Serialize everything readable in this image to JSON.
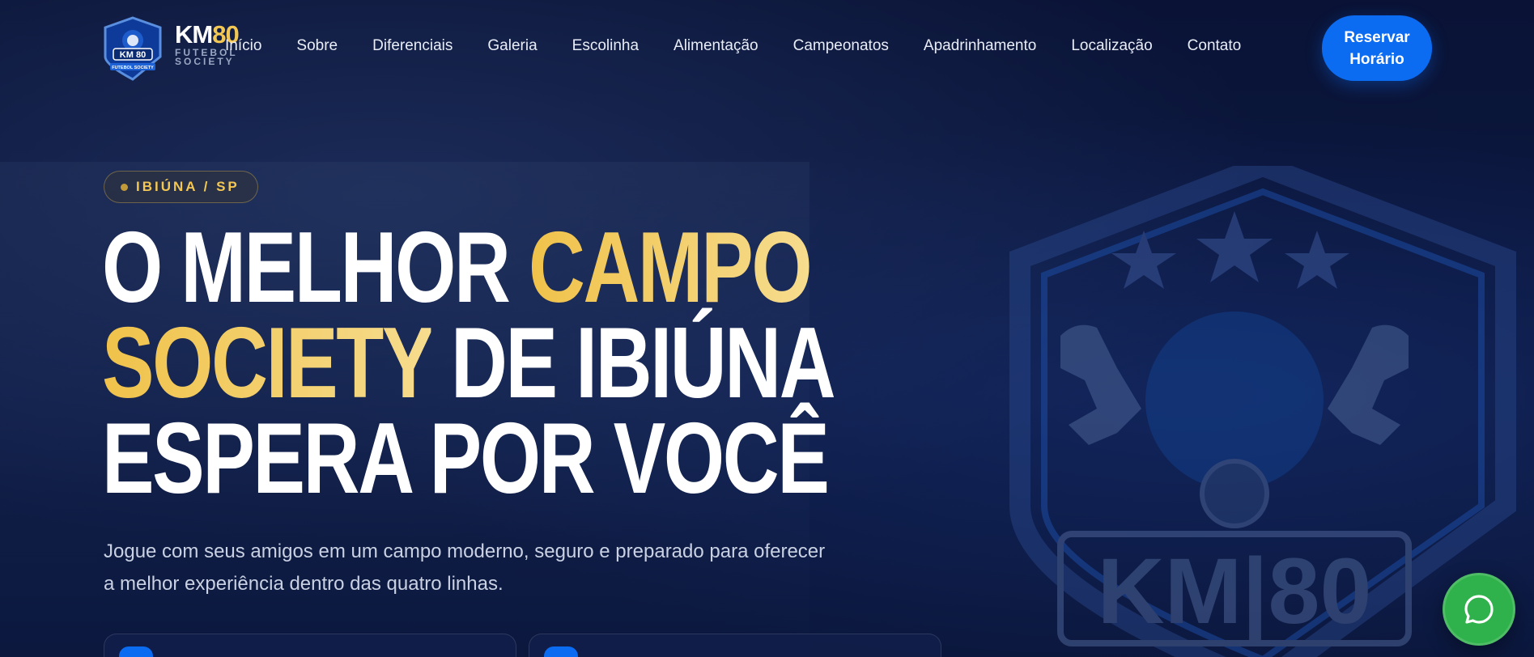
{
  "header": {
    "logo": {
      "brand_main": "KM",
      "brand_accent": "80",
      "brand_sub_1": "FUTEBOL",
      "brand_sub_2": "SOCIETY",
      "badge_text": "KM 80",
      "badge_ribbon": "FUTEBOL SOCIETY"
    },
    "nav": [
      "Início",
      "Sobre",
      "Diferenciais",
      "Galeria",
      "Escolinha",
      "Alimentação",
      "Campeonatos",
      "Apadrinhamento",
      "Localização",
      "Contato"
    ],
    "cta_line1": "Reservar",
    "cta_line2": "Horário"
  },
  "hero": {
    "location": "IBIÚNA / SP",
    "title": {
      "l1_white": "O MELHOR ",
      "l1_gold": "CAMPO",
      "l2_gold": "SOCIETY",
      "l2_white": " DE IBIÚNA",
      "l3_white": "ESPERA POR VOCÊ"
    },
    "description": "Jogue com seus amigos em um campo moderno, seguro e preparado para oferecer a melhor experiência dentro das quatro linhas.",
    "watermark_text": "KM|80"
  },
  "colors": {
    "background": "#0a1438",
    "accent_blue": "#0b6cf2",
    "gold": "#f3c754",
    "whatsapp_green": "#2fb24b"
  },
  "icons": {
    "whatsapp": "whatsapp-icon",
    "location_dot": "dot-icon"
  }
}
